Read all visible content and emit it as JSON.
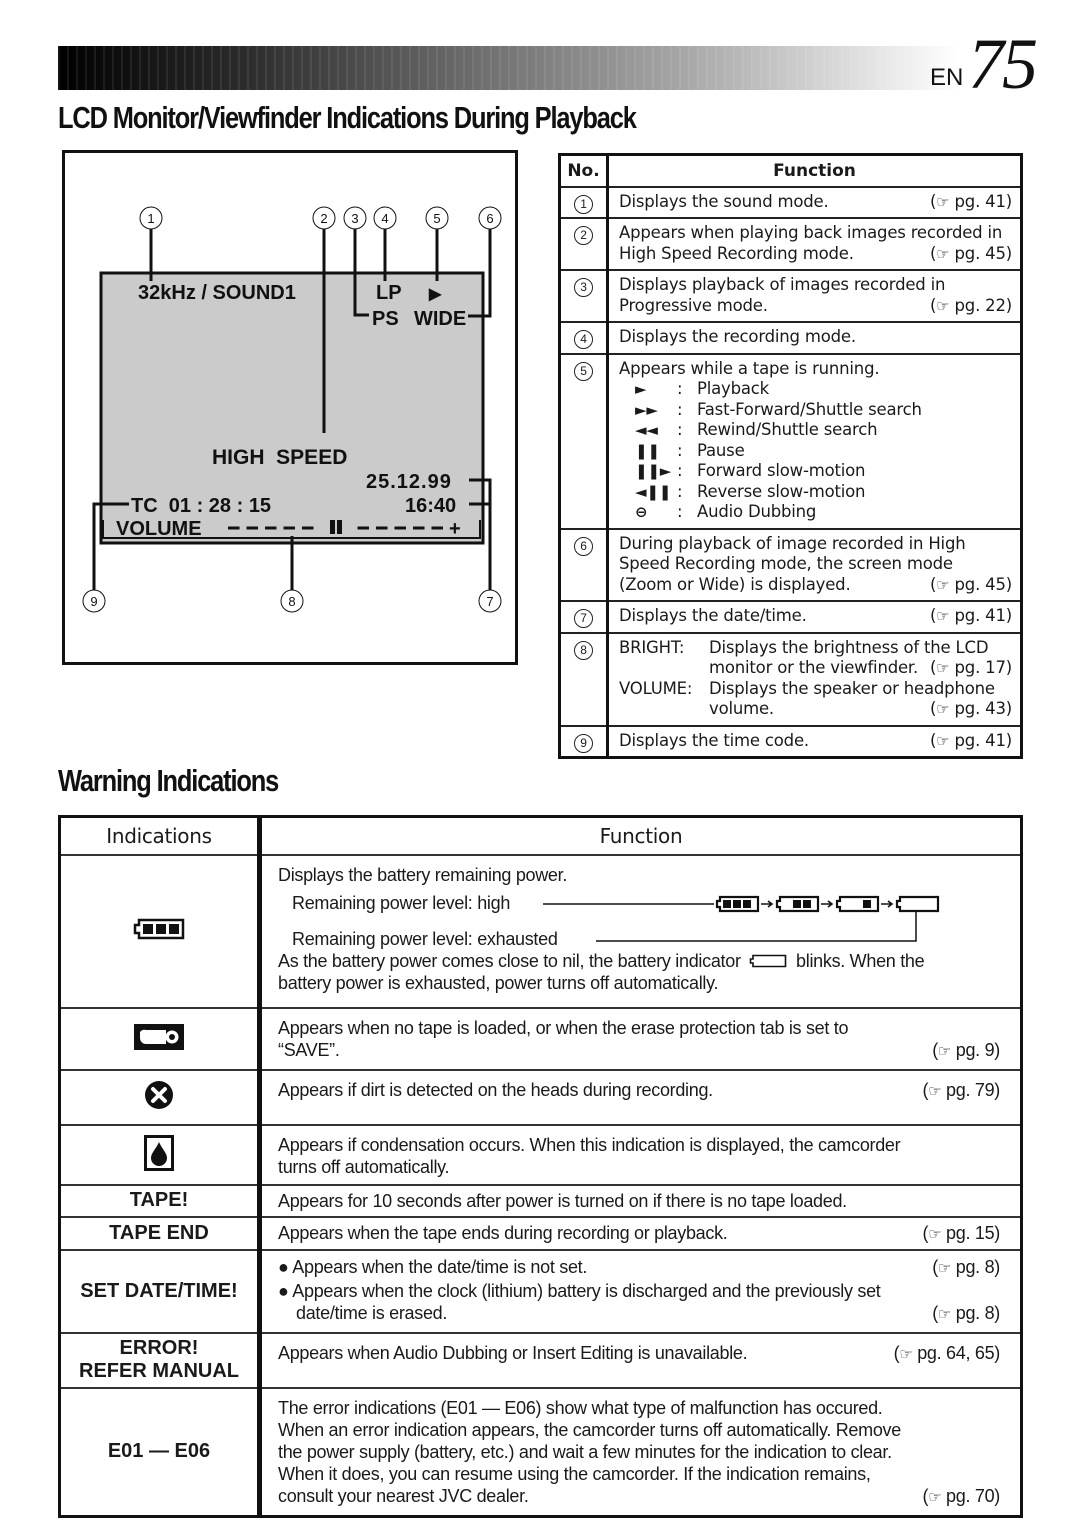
{
  "header": {
    "lang": "EN",
    "page_number": "75"
  },
  "section1": {
    "title": "LCD Monitor/Viewfinder Indications During Playback",
    "diagram": {
      "callouts": [
        "1",
        "2",
        "3",
        "4",
        "5",
        "6",
        "7",
        "8",
        "9"
      ],
      "sound_mode": "32kHz / SOUND1",
      "rec_mode": "LP",
      "tape_symbol": "▶",
      "progressive": "PS",
      "screen_mode": "WIDE",
      "high_speed": "HIGH  SPEED",
      "date": "25.12.99",
      "time": "16:40",
      "timecode": "TC  01 : 28 : 15",
      "volume_label": "VOLUME",
      "volume_level_fraction": 0.5
    },
    "table": {
      "headers": {
        "no": "No.",
        "function": "Function"
      },
      "rows": [
        {
          "no": "1",
          "lines": [
            {
              "text": "Displays the sound mode.",
              "ref": "pg. 41"
            }
          ]
        },
        {
          "no": "2",
          "lines": [
            {
              "text": "Appears when playing back images recorded in",
              "ref": ""
            },
            {
              "text": "High Speed Recording mode.",
              "ref": "pg. 45"
            }
          ]
        },
        {
          "no": "3",
          "lines": [
            {
              "text": "Displays playback of images recorded in",
              "ref": ""
            },
            {
              "text": "Progressive mode.",
              "ref": "pg. 22"
            }
          ]
        },
        {
          "no": "4",
          "lines": [
            {
              "text": "Displays the recording mode.",
              "ref": ""
            }
          ]
        },
        {
          "no": "5",
          "intro": "Appears while a tape is running.",
          "symbols": [
            {
              "icon": "play",
              "glyph": "►",
              "label": "Playback"
            },
            {
              "icon": "fast-forward",
              "glyph": "►►",
              "label": "Fast-Forward/Shuttle search"
            },
            {
              "icon": "rewind",
              "glyph": "◄◄",
              "label": "Rewind/Shuttle search"
            },
            {
              "icon": "pause",
              "glyph": "❚❚",
              "label": "Pause"
            },
            {
              "icon": "forward-slow",
              "glyph": "❚❚►",
              "label": "Forward slow-motion"
            },
            {
              "icon": "reverse-slow",
              "glyph": "◄❚❚",
              "label": "Reverse slow-motion"
            },
            {
              "icon": "audio-dubbing",
              "glyph": "⊖",
              "label": "Audio Dubbing"
            }
          ]
        },
        {
          "no": "6",
          "lines": [
            {
              "text": "During playback of image recorded in High",
              "ref": ""
            },
            {
              "text": "Speed Recording mode, the screen mode",
              "ref": ""
            },
            {
              "text": "(Zoom or Wide) is displayed.",
              "ref": "pg. 45"
            }
          ]
        },
        {
          "no": "7",
          "lines": [
            {
              "text": "Displays the date/time.",
              "ref": "pg. 41"
            }
          ]
        },
        {
          "no": "8",
          "entries": [
            {
              "key": "BRIGHT:",
              "lines": [
                {
                  "text": "Displays the brightness of the LCD",
                  "ref": ""
                },
                {
                  "text": "monitor or the viewfinder.",
                  "ref": "pg. 17"
                }
              ]
            },
            {
              "key": "VOLUME:",
              "lines": [
                {
                  "text": "Displays the speaker or headphone",
                  "ref": ""
                },
                {
                  "text": "volume.",
                  "ref": "pg. 43"
                }
              ]
            }
          ]
        },
        {
          "no": "9",
          "lines": [
            {
              "text": "Displays the time code.",
              "ref": "pg. 41"
            }
          ]
        }
      ]
    }
  },
  "section2": {
    "title": "Warning Indications",
    "headers": {
      "indications": "Indications",
      "function": "Function"
    },
    "battery": {
      "intro": "Displays the battery remaining power.",
      "high_label": "Remaining power level: high",
      "exhausted_label": "Remaining power level: exhausted",
      "levels": [
        3,
        2,
        1,
        0
      ],
      "note_before": "As the battery power comes close to nil, the battery indicator",
      "note_after": "blinks. When the",
      "note_line2": "battery power is exhausted, power turns off automatically."
    },
    "tape": {
      "line1": "Appears when no tape is loaded, or when the erase protection tab is set to",
      "line2": "“SAVE”.",
      "ref": "pg. 9"
    },
    "heads": {
      "text": "Appears if dirt is detected on the heads during recording.",
      "ref": "pg. 79"
    },
    "condensation": {
      "line1": "Appears if condensation occurs. When this indication is displayed, the camcorder",
      "line2": "turns off automatically."
    },
    "tape_warn": {
      "label": "TAPE!",
      "text": "Appears for 10 seconds after power is turned on if there is no tape loaded."
    },
    "tape_end": {
      "label": "TAPE END",
      "text": "Appears when the tape ends during recording or playback.",
      "ref": "pg. 15"
    },
    "set_date": {
      "label": "SET DATE/TIME!",
      "bullet1": "Appears when the date/time is not set.",
      "ref1": "pg. 8",
      "bullet2": "Appears when the clock (lithium) battery is discharged and the previously set",
      "bullet2_cont": "date/time is erased.",
      "ref2": "pg. 8"
    },
    "error": {
      "label1": "ERROR!",
      "label2": "REFER MANUAL",
      "text": "Appears when Audio Dubbing or Insert Editing is unavailable.",
      "ref": "pg. 64, 65"
    },
    "e01": {
      "label": "E01 — E06",
      "lines": [
        "The error indications (E01 — E06) show what type of malfunction has occured.",
        "When an error indication appears, the camcorder turns off automatically. Remove",
        "the power supply (battery, etc.) and wait a few minutes for the indication to clear.",
        "When it does, you can resume using the camcorder. If the indication remains,",
        "consult your nearest JVC dealer."
      ],
      "ref": "pg. 70"
    }
  }
}
